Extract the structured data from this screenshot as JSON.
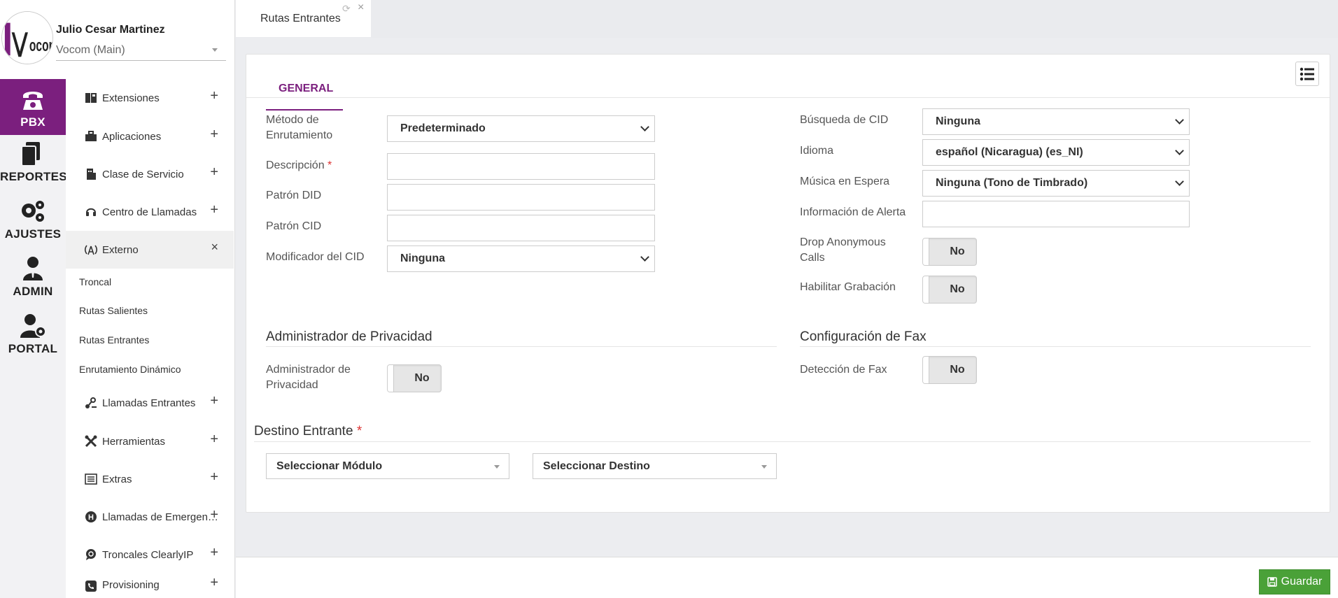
{
  "user": {
    "name": "Julio Cesar Martinez",
    "company": "Vocom (Main)",
    "logo_text": "vocom"
  },
  "rail": [
    {
      "label": "PBX",
      "icon": "phone-icon",
      "active": true
    },
    {
      "label": "REPORTES",
      "icon": "documents-icon"
    },
    {
      "label": "AJUSTES",
      "icon": "gears-icon"
    },
    {
      "label": "ADMIN",
      "icon": "admin-user-icon"
    },
    {
      "label": "PORTAL",
      "icon": "user-gear-icon"
    }
  ],
  "menu": {
    "items": [
      {
        "label": "Extensiones",
        "icon": "phone-book-icon",
        "expander": "+"
      },
      {
        "label": "Aplicaciones",
        "icon": "briefcase-icon",
        "expander": "+"
      },
      {
        "label": "Clase de Servicio",
        "icon": "building-icon",
        "expander": "+"
      },
      {
        "label": "Centro de Llamadas",
        "icon": "headset-icon",
        "expander": "+"
      },
      {
        "label": "Externo",
        "icon": "antenna-icon",
        "expander": "×"
      },
      {
        "label": "Llamadas Entrantes",
        "icon": "incoming-call-icon",
        "expander": "+"
      },
      {
        "label": "Herramientas",
        "icon": "tools-icon",
        "expander": "+"
      },
      {
        "label": "Extras",
        "icon": "list-icon",
        "expander": "+"
      },
      {
        "label": "Llamadas de Emergen…",
        "icon": "hospital-icon",
        "expander": "+"
      },
      {
        "label": "Troncales ClearlyIP",
        "icon": "chat-icon",
        "expander": "+"
      },
      {
        "label": "Provisioning",
        "icon": "phone-square-icon",
        "expander": "+"
      }
    ],
    "sub_items": [
      "Troncal",
      "Rutas Salientes",
      "Rutas Entrantes",
      "Enrutamiento Dinámico"
    ]
  },
  "tab": {
    "title": "Rutas Entrantes",
    "refresh_icon": "⟳",
    "close_icon": "×"
  },
  "card": {
    "tab_general": "GENERAL",
    "left": {
      "routing_method": {
        "label": "Método de Enrutamiento",
        "value": "Predeterminado"
      },
      "description": {
        "label": "Descripción",
        "required": "*",
        "value": ""
      },
      "did_pattern": {
        "label": "Patrón DID",
        "value": ""
      },
      "cid_pattern": {
        "label": "Patrón CID",
        "value": ""
      },
      "cid_modifier": {
        "label": "Modificador del CID",
        "value": "Ninguna"
      }
    },
    "right": {
      "cid_lookup": {
        "label": "Búsqueda de CID",
        "value": "Ninguna"
      },
      "language": {
        "label": "Idioma",
        "value": "español (Nicaragua) (es_NI)"
      },
      "moh": {
        "label": "Música en Espera",
        "value": "Ninguna (Tono de Timbrado)"
      },
      "alert_info": {
        "label": "Información de Alerta",
        "value": ""
      },
      "drop_anonymous": {
        "label": "Drop Anonymous Calls",
        "value": "No"
      },
      "recording": {
        "label": "Habilitar Grabación",
        "value": "No"
      }
    },
    "privacy": {
      "title": "Administrador de Privacidad",
      "label": "Administrador de Privacidad",
      "value": "No"
    },
    "fax": {
      "title": "Configuración de Fax",
      "label": "Detección de Fax",
      "value": "No"
    },
    "destination": {
      "title": "Destino Entrante",
      "required": "*",
      "module_placeholder": "Seleccionar Módulo",
      "dest_placeholder": "Seleccionar Destino"
    }
  },
  "footer": {
    "save_label": "Guardar"
  },
  "colors": {
    "brand": "#7b1f7e",
    "save": "#4aa138"
  }
}
